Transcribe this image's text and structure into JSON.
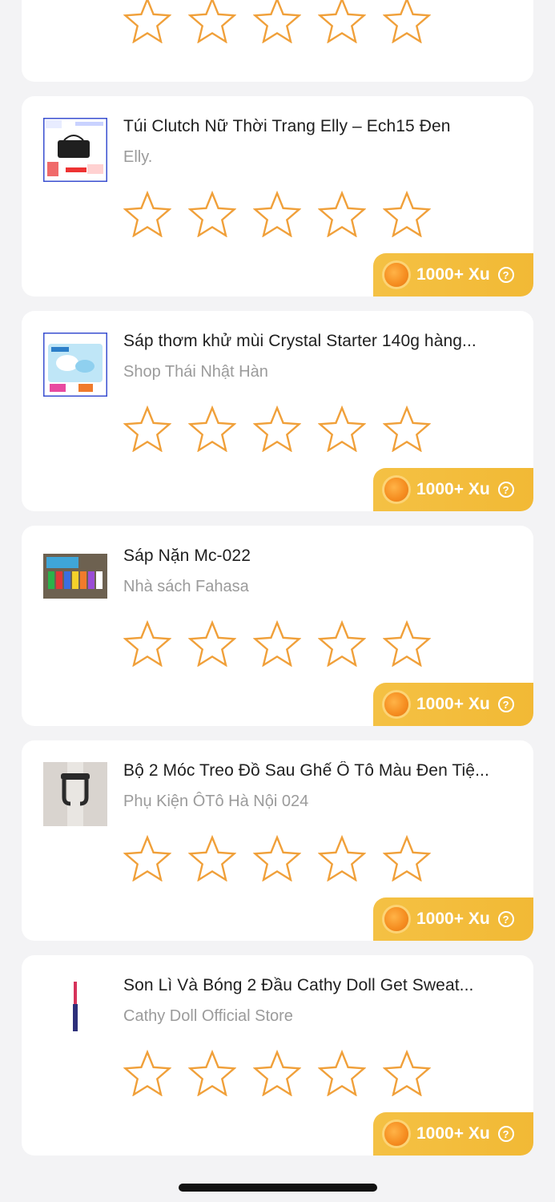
{
  "reward": {
    "label": "1000+ Xu",
    "help_glyph": "?"
  },
  "rating": {
    "max_stars": 5,
    "current": 0,
    "star_color": "#f0a03a"
  },
  "products": [
    {
      "title": "Túi Clutch Nữ Thời Trang Elly – Ech15 Đen",
      "shop": "Elly.",
      "thumb_icon": "handbag-thumbnail-icon"
    },
    {
      "title": "Sáp thơm khử mùi Crystal Starter 140g hàng...",
      "shop": "Shop Thái Nhật Hàn",
      "thumb_icon": "air-freshener-box-thumbnail-icon"
    },
    {
      "title": "Sáp Nặn Mc-022",
      "shop": "Nhà sách Fahasa",
      "thumb_icon": "modeling-clay-thumbnail-icon"
    },
    {
      "title": "Bộ 2 Móc Treo Đồ Sau Ghế Ô Tô Màu Đen Tiệ...",
      "shop": "Phụ Kiện ÔTô Hà Nội 024",
      "thumb_icon": "car-seat-hook-thumbnail-icon"
    },
    {
      "title": "Son Lì Và Bóng 2 Đầu Cathy Doll Get Sweat...",
      "shop": "Cathy Doll Official Store",
      "thumb_icon": "lipstick-thumbnail-icon"
    }
  ]
}
